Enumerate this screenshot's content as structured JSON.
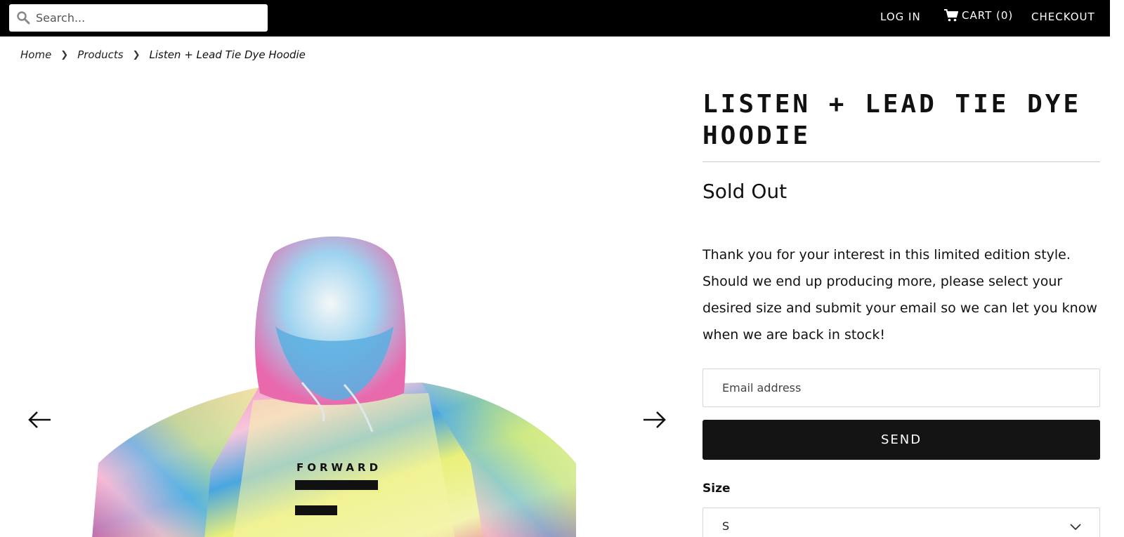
{
  "header": {
    "search": {
      "placeholder": "Search...",
      "value": ""
    },
    "login_label": "LOG IN",
    "cart_label": "CART (0)",
    "checkout_label": "CHECKOUT"
  },
  "breadcrumb": {
    "home": "Home",
    "products": "Products",
    "current": "Listen + Lead Tie Dye Hoodie"
  },
  "gallery": {
    "print_text": "FORWARD"
  },
  "product": {
    "title": "LISTEN + LEAD TIE DYE HOODIE",
    "status": "Sold Out",
    "description": "Thank you for your interest in this limited edition style. Should we end up producing more, please select your desired size and submit your email so we can let you know when we are back in stock!",
    "email_placeholder": "Email address",
    "send_label": "SEND",
    "size_label": "Size",
    "size_value": "S"
  },
  "colors": {
    "topbar": "#000000",
    "button": "#141414",
    "text": "#111111"
  },
  "icons": [
    "search-icon",
    "cart-icon",
    "arrow-left-icon",
    "arrow-right-icon",
    "chevron-down-icon"
  ]
}
